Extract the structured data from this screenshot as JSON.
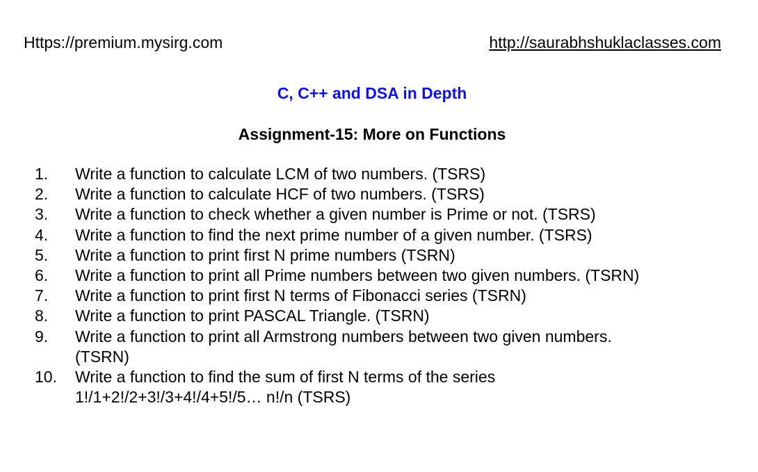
{
  "header": {
    "left_text": "Https://premium.mysirg.com",
    "right_link": "http://saurabhshuklaclasses.com"
  },
  "title": "C, C++ and DSA in Depth",
  "subtitle": "Assignment-15: More on Functions",
  "colors": {
    "title": "#1010ee",
    "text": "#000000"
  },
  "questions": [
    {
      "num": "1.",
      "text": "Write a function to calculate LCM of two numbers. (TSRS)"
    },
    {
      "num": "2.",
      "text": "Write a function to calculate HCF of two numbers. (TSRS)"
    },
    {
      "num": "3.",
      "text": "Write a function to check whether a given number is Prime or not. (TSRS)"
    },
    {
      "num": "4.",
      "text": "Write a function to find the next prime number of a given number. (TSRS)"
    },
    {
      "num": "5.",
      "text": "Write a function to print first N prime numbers (TSRN)"
    },
    {
      "num": "6.",
      "text": "Write a function to print all Prime numbers between two given numbers. (TSRN)"
    },
    {
      "num": "7.",
      "text": "Write a function to print first N terms of Fibonacci series (TSRN)"
    },
    {
      "num": "8.",
      "text": "Write a function to print PASCAL Triangle. (TSRN)"
    },
    {
      "num": "9.",
      "text": "Write a function to print all Armstrong numbers between two given numbers. (TSRN)"
    },
    {
      "num": "10.",
      "text": "Write a function to find the sum of first N terms of the series 1!/1+2!/2+3!/3+4!/4+5!/5… n!/n (TSRS)"
    }
  ]
}
